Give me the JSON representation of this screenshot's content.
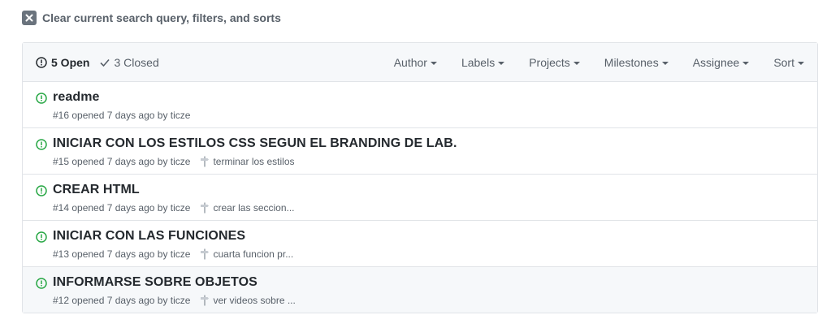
{
  "clear_label": "Clear current search query, filters, and sorts",
  "header": {
    "open_label": "5 Open",
    "closed_label": "3 Closed",
    "filters": [
      {
        "name": "author",
        "label": "Author"
      },
      {
        "name": "labels",
        "label": "Labels"
      },
      {
        "name": "projects",
        "label": "Projects"
      },
      {
        "name": "milestones",
        "label": "Milestones"
      },
      {
        "name": "assignee",
        "label": "Assignee"
      },
      {
        "name": "sort",
        "label": "Sort"
      }
    ]
  },
  "issues": [
    {
      "title": "readme",
      "meta": "#16 opened 7 days ago by ticze",
      "milestone": ""
    },
    {
      "title": "INICIAR CON LOS ESTILOS CSS SEGUN EL BRANDING DE LAB.",
      "meta": "#15 opened 7 days ago by ticze",
      "milestone": "terminar los estilos"
    },
    {
      "title": "CREAR HTML",
      "meta": "#14 opened 7 days ago by ticze",
      "milestone": "crear las seccion..."
    },
    {
      "title": "INICIAR CON LAS FUNCIONES",
      "meta": "#13 opened 7 days ago by ticze",
      "milestone": "cuarta funcion pr..."
    },
    {
      "title": "INFORMARSE SOBRE OBJETOS",
      "meta": "#12 opened 7 days ago by ticze",
      "milestone": "ver videos sobre ..."
    }
  ],
  "colors": {
    "open_icon": "#28a745",
    "header_bg": "#f6f8fa",
    "border": "#e1e4e8",
    "muted": "#586069"
  },
  "icons": {
    "clear": "x-icon",
    "open": "issue-opened-icon",
    "closed": "check-icon",
    "milestone": "milestone-icon",
    "caret": "caret-down-icon"
  }
}
